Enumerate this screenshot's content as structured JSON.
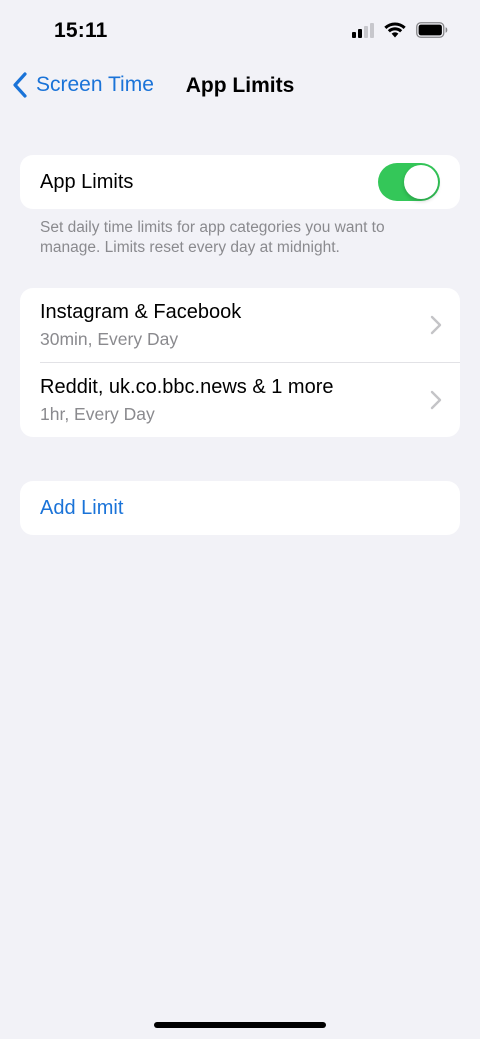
{
  "status_bar": {
    "time": "15:11",
    "signal_icon": "cellular-signal-icon",
    "wifi_icon": "wifi-icon",
    "battery_icon": "battery-icon"
  },
  "nav": {
    "back_label": "Screen Time",
    "title": "App Limits"
  },
  "app_limits_toggle": {
    "label": "App Limits",
    "enabled": true,
    "accent_color": "#34c759"
  },
  "footnote": "Set daily time limits for app categories you want to manage. Limits reset every day at midnight.",
  "limits": [
    {
      "title": "Instagram & Facebook",
      "subtitle": "30min, Every Day"
    },
    {
      "title": "Reddit, uk.co.bbc.news & 1 more",
      "subtitle": "1hr, Every Day"
    }
  ],
  "add_limit": {
    "label": "Add Limit"
  },
  "colors": {
    "link": "#1a73d8",
    "background": "#f2f2f7",
    "secondary_text": "#8a8a8e"
  }
}
